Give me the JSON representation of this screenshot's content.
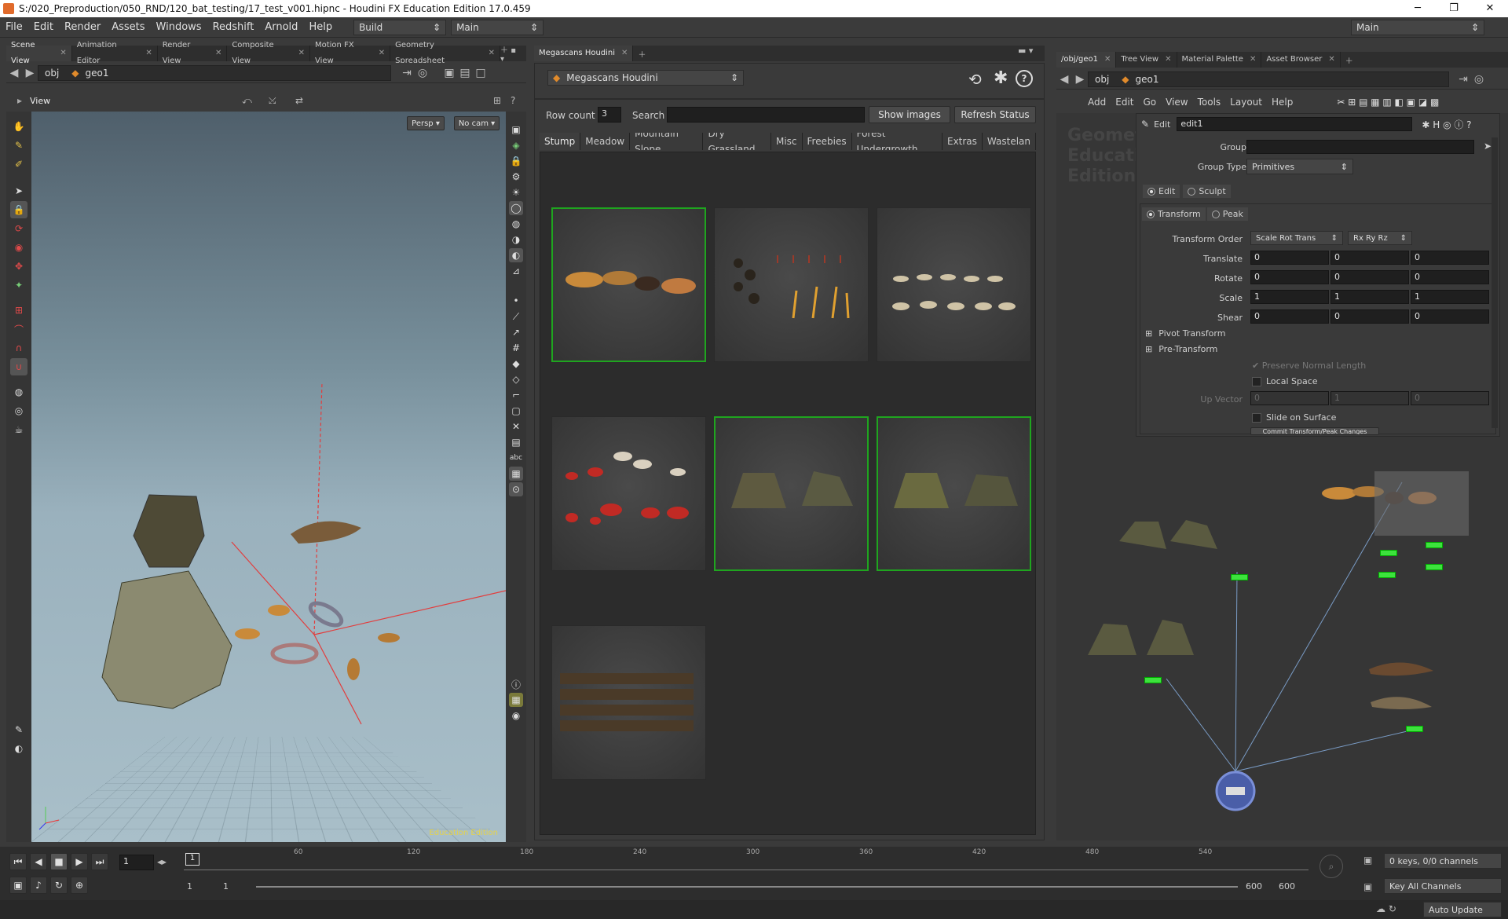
{
  "window": {
    "title": "S:/020_Preproduction/050_RND/120_bat_testing/17_test_v001.hipnc - Houdini FX Education Edition 17.0.459",
    "min": "─",
    "max": "❐",
    "close": "✕"
  },
  "menu": {
    "items": [
      "File",
      "Edit",
      "Render",
      "Assets",
      "Windows",
      "Redshift",
      "Arnold",
      "Help"
    ],
    "desktop1": "Build",
    "desktop2": "Main",
    "right_desktop": "Main"
  },
  "left_panel": {
    "tabs": [
      "Scene View",
      "Animation Editor",
      "Render View",
      "Composite View",
      "Motion FX View",
      "Geometry Spreadsheet"
    ],
    "path_obj": "obj",
    "path_geo": "geo1",
    "view_label": "View",
    "persp": "Persp ▾",
    "nocam": "No cam ▾",
    "watermark": "Education Edition"
  },
  "mid_panel": {
    "tab": "Megascans Houdini",
    "dropdown": "Megascans Houdini",
    "row_count_label": "Row count",
    "row_count": "3",
    "search_label": "Search",
    "search_value": "",
    "show_images": "Show images",
    "refresh": "Refresh Status",
    "categories": [
      "Stump",
      "Meadow",
      "Mountain Slope",
      "Dry Grassland",
      "Misc",
      "Freebies",
      "Forest Undergrowth",
      "Extras",
      "Wastelan"
    ]
  },
  "right_panel": {
    "tabs": [
      "/obj/geo1",
      "Tree View",
      "Material Palette",
      "Asset Browser"
    ],
    "path_obj": "obj",
    "path_geo": "geo1",
    "menu": [
      "Add",
      "Edit",
      "Go",
      "View",
      "Tools",
      "Layout",
      "Help"
    ],
    "watermark": "Geometry Education Edition",
    "node_type": "Edit",
    "node_name": "edit1",
    "group_label": "Group",
    "group_value": "",
    "group_type_label": "Group Type",
    "group_type": "Primitives",
    "mode_edit": "Edit",
    "mode_sculpt": "Sculpt",
    "sub_transform": "Transform",
    "sub_peak": "Peak",
    "xform_order_label": "Transform Order",
    "xform_order": "Scale Rot Trans",
    "rot_order": "Rx Ry Rz",
    "translate_label": "Translate",
    "translate": [
      "0",
      "0",
      "0"
    ],
    "rotate_label": "Rotate",
    "rotate": [
      "0",
      "0",
      "0"
    ],
    "scale_label": "Scale",
    "scale": [
      "1",
      "1",
      "1"
    ],
    "shear_label": "Shear",
    "shear": [
      "0",
      "0",
      "0"
    ],
    "pivot_label": "Pivot Transform",
    "pre_label": "Pre-Transform",
    "preserve": "Preserve Normal Length",
    "local": "Local Space",
    "upvec_label": "Up Vector",
    "upvec": [
      "0",
      "1",
      "0"
    ],
    "slide": "Slide on Surface",
    "commit": "Commit Transform/Peak Changes"
  },
  "timeline": {
    "frame": "1",
    "ticks": [
      "60",
      "120",
      "180",
      "240",
      "300",
      "360",
      "420",
      "480",
      "540"
    ],
    "start": "1",
    "start2": "1",
    "end": "600",
    "end2": "600",
    "keys": "0 keys, 0/0 channels",
    "key_all": "Key All Channels",
    "auto_update": "Auto Update",
    "current": "1"
  }
}
